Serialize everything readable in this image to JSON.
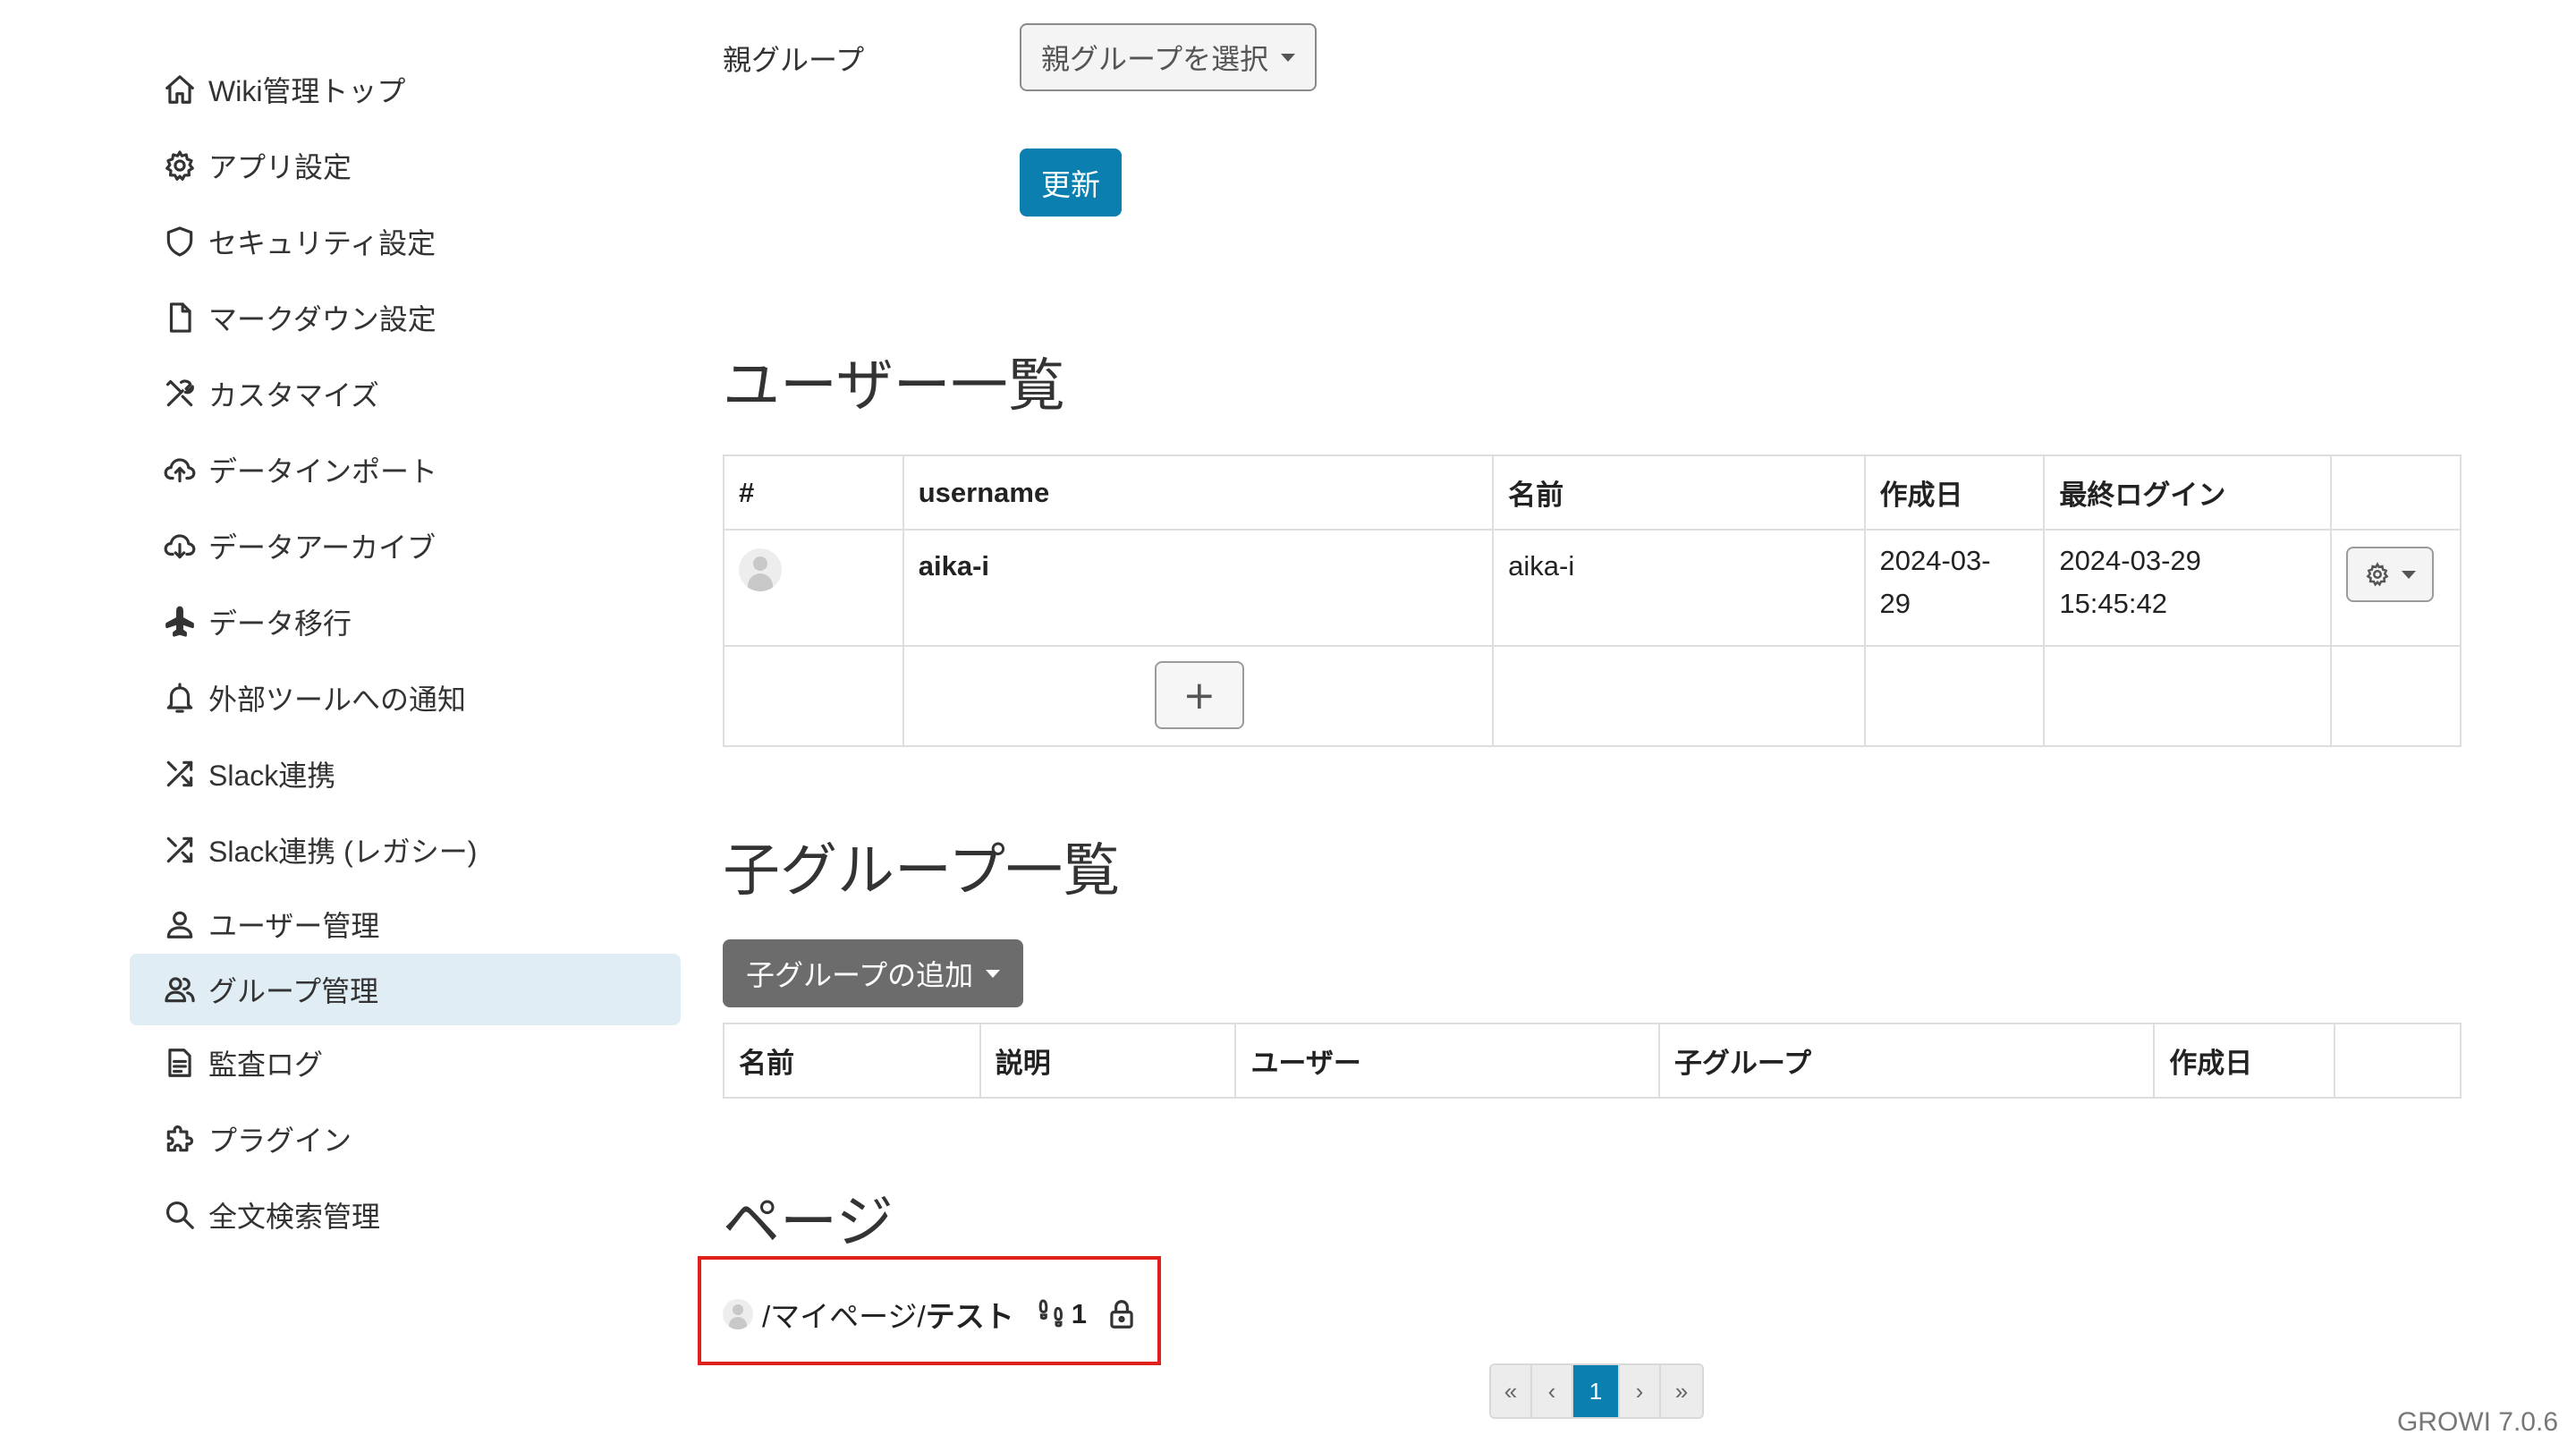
{
  "sidebar": {
    "items": [
      {
        "label": "Wiki管理トップ",
        "icon": "home-icon",
        "active": false
      },
      {
        "label": "アプリ設定",
        "icon": "gear-icon",
        "active": false
      },
      {
        "label": "セキュリティ設定",
        "icon": "shield-icon",
        "active": false
      },
      {
        "label": "マークダウン設定",
        "icon": "file-icon",
        "active": false
      },
      {
        "label": "カスタマイズ",
        "icon": "tools-icon",
        "active": false
      },
      {
        "label": "データインポート",
        "icon": "cloud-upload-icon",
        "active": false
      },
      {
        "label": "データアーカイブ",
        "icon": "cloud-download-icon",
        "active": false
      },
      {
        "label": "データ移行",
        "icon": "airplane-icon",
        "active": false
      },
      {
        "label": "外部ツールへの通知",
        "icon": "bell-icon",
        "active": false
      },
      {
        "label": "Slack連携",
        "icon": "shuffle-icon",
        "active": false
      },
      {
        "label": "Slack連携 (レガシー)",
        "icon": "shuffle-icon",
        "active": false
      },
      {
        "label": "ユーザー管理",
        "icon": "person-icon",
        "active": false
      },
      {
        "label": "グループ管理",
        "icon": "people-icon",
        "active": true
      },
      {
        "label": "監査ログ",
        "icon": "document-icon",
        "active": false
      },
      {
        "label": "プラグイン",
        "icon": "puzzle-icon",
        "active": false
      },
      {
        "label": "全文検索管理",
        "icon": "search-icon",
        "active": false
      }
    ]
  },
  "parent_group": {
    "label": "親グループ",
    "select_label": "親グループを選択",
    "update_label": "更新"
  },
  "users_section": {
    "title": "ユーザー一覧",
    "headers": [
      "#",
      "username",
      "名前",
      "作成日",
      "最終ログイン",
      ""
    ],
    "rows": [
      {
        "username": "aika-i",
        "name": "aika-i",
        "created_line1": "2024-03-",
        "created_line2": "29",
        "last_login_line1": "2024-03-29",
        "last_login_line2": "15:45:42"
      }
    ],
    "add_label": "+"
  },
  "child_groups": {
    "title": "子グループ一覧",
    "add_label": "子グループの追加",
    "headers": [
      "名前",
      "説明",
      "ユーザー",
      "子グループ",
      "作成日",
      ""
    ]
  },
  "pages": {
    "title": "ページ",
    "items": [
      {
        "path_prefix": "/マイページ/",
        "path_name": "テスト",
        "footprint_count": "1"
      }
    ]
  },
  "pagination": {
    "first": "«",
    "prev": "‹",
    "current": "1",
    "next": "›",
    "last": "»"
  },
  "version": "GROWI 7.0.6",
  "colors": {
    "accent": "#0a7fb0",
    "sidebar_active_bg": "#e1edf5",
    "highlight_border": "#e0201b",
    "secondary_button": "#6c6c6c"
  }
}
